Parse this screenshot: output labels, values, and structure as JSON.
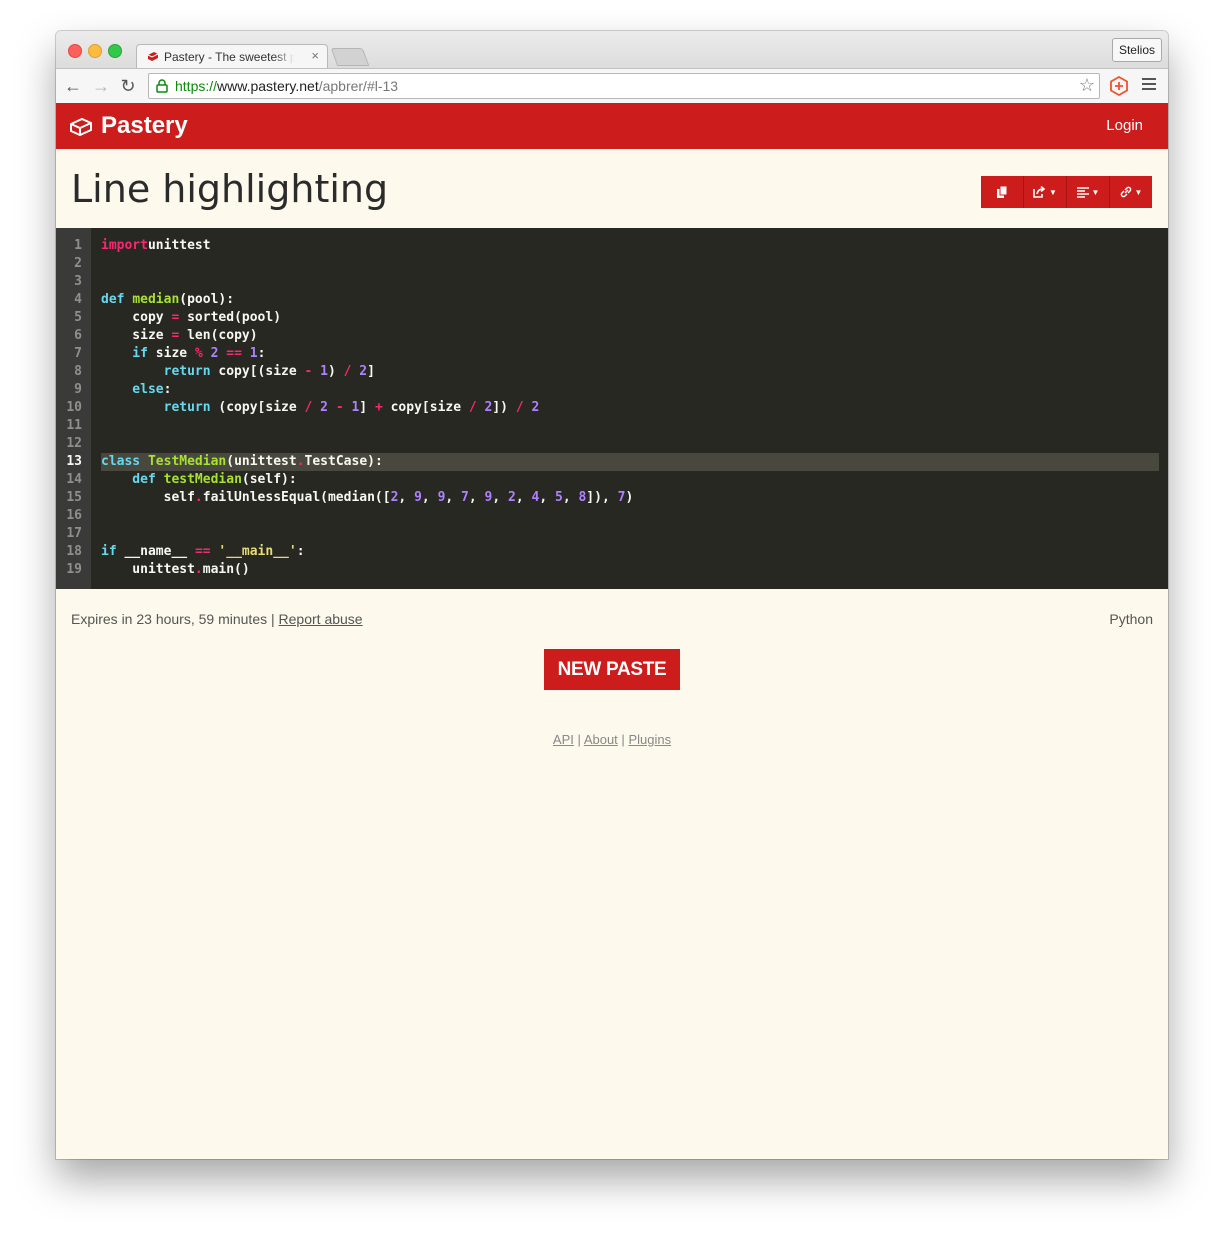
{
  "browser": {
    "tab_title": "Pastery - The sweetest paste",
    "profile_name": "Stelios",
    "url_scheme": "https://",
    "url_host": "www.pastery.net",
    "url_path": "/apbrer/#l-13"
  },
  "site": {
    "brand": "Pastery",
    "login_label": "Login",
    "brand_color": "#cd1c1c"
  },
  "paste": {
    "title": "Line highlighting",
    "highlighted_line": 13,
    "line_numbers": [
      "1",
      "2",
      "3",
      "4",
      "5",
      "6",
      "7",
      "8",
      "9",
      "10",
      "11",
      "12",
      "13",
      "14",
      "15",
      "16",
      "17",
      "18",
      "19"
    ],
    "expires": "Expires in 23 hours, 59 minutes",
    "separator": "|",
    "report_label": "Report abuse",
    "language": "Python"
  },
  "new_paste_label": "NEW PASTE",
  "footer": {
    "api_label": "API",
    "about_label": "About",
    "plugins_label": "Plugins",
    "sep": "|"
  }
}
